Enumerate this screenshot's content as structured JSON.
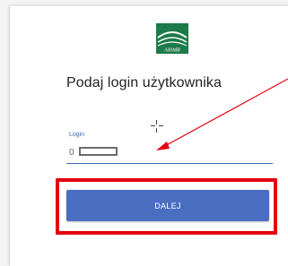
{
  "logo": {
    "icon": "arimr-logo-icon",
    "text": "ARiMR",
    "color": "#1d7a4a"
  },
  "heading": "Podaj login użytkownika",
  "login_field": {
    "label": "Login",
    "value": "0"
  },
  "submit_button": {
    "label": "DALEJ",
    "color": "#4a6ec0"
  },
  "annotation": {
    "highlight_color": "#e2000f",
    "arrow_color": "#e2000f"
  }
}
